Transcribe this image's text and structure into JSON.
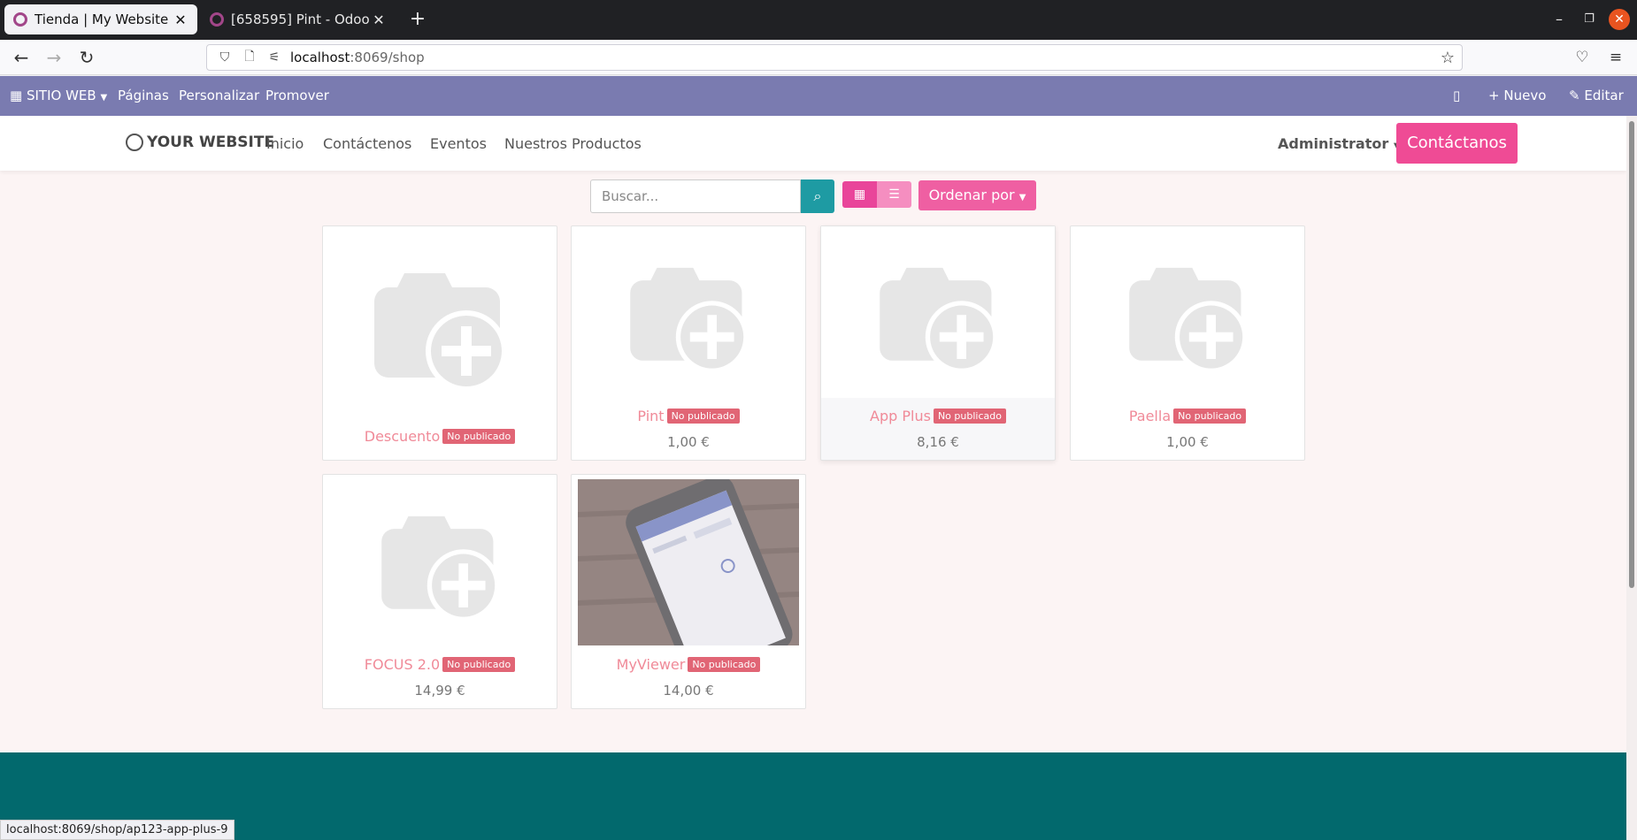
{
  "browser": {
    "tabs": [
      {
        "title": "Tienda | My Website",
        "active": true
      },
      {
        "title": "[658595] Pint - Odoo",
        "active": false
      }
    ],
    "url": {
      "host": "localhost",
      "path": ":8069/shop"
    },
    "status_url": "localhost:8069/shop/ap123-app-plus-9"
  },
  "odoo_bar": {
    "apps_label": "SITIO WEB",
    "menu": [
      "Páginas",
      "Personalizar",
      "Promover"
    ],
    "new_label": "Nuevo",
    "edit_label": "Editar"
  },
  "site": {
    "brand": "YOUR WEBSITE",
    "nav": [
      "Inicio",
      "Contáctenos",
      "Eventos",
      "Nuestros Productos"
    ],
    "user": "Administrator",
    "cta": "Contáctanos"
  },
  "shop": {
    "search_placeholder": "Buscar...",
    "sort_label": "Ordenar por",
    "products": [
      {
        "name": "Descuento",
        "badge": "No publicado",
        "price": ""
      },
      {
        "name": "Pint",
        "badge": "No publicado",
        "price": "1,00 €"
      },
      {
        "name": "App Plus",
        "badge": "No publicado",
        "price": "8,16 €"
      },
      {
        "name": "Paella",
        "badge": "No publicado",
        "price": "1,00 €"
      },
      {
        "name": "FOCUS 2.0",
        "badge": "No publicado",
        "price": "14,99 €"
      },
      {
        "name": "MyViewer",
        "badge": "No publicado",
        "price": "14,00 €"
      }
    ]
  },
  "colors": {
    "odoo_bar": "#7a7bb0",
    "primary_pink": "#ef4b95",
    "teal": "#1e9ba3",
    "footer": "#02696d",
    "badge": "#e16575"
  }
}
